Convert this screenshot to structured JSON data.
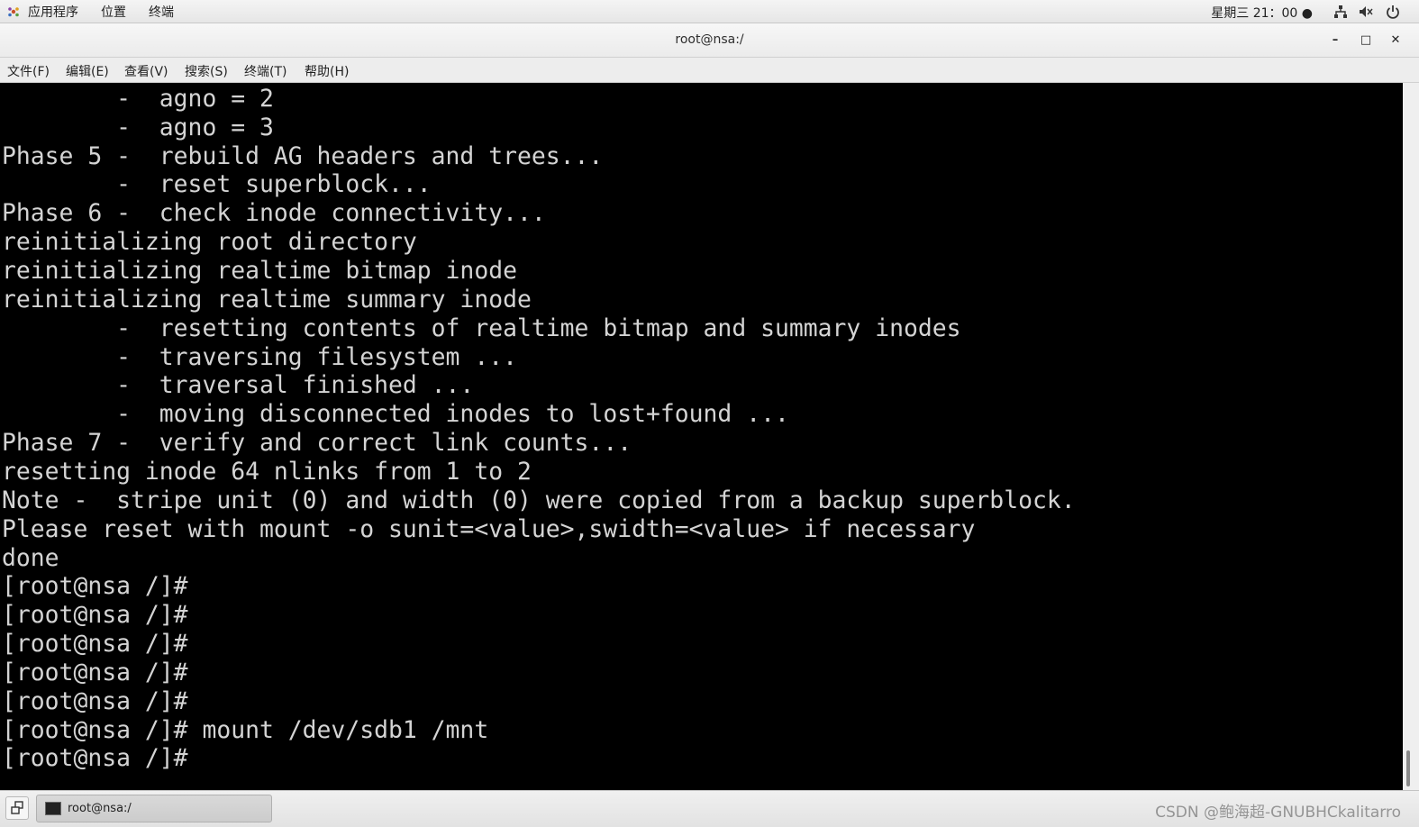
{
  "top_panel": {
    "apps_menu": "应用程序",
    "places_menu": "位置",
    "terminal_menu": "终端",
    "clock": "星期三 21：00 ●",
    "tray_icons": [
      "network-icon",
      "volume-icon",
      "power-icon"
    ]
  },
  "window": {
    "title": "root@nsa:/",
    "minimize": "–",
    "maximize": "□",
    "close": "✕"
  },
  "menu_bar": {
    "items": [
      {
        "label": "文件(F)"
      },
      {
        "label": "编辑(E)"
      },
      {
        "label": "查看(V)"
      },
      {
        "label": "搜索(S)"
      },
      {
        "label": "终端(T)"
      },
      {
        "label": "帮助(H)"
      }
    ]
  },
  "terminal": {
    "lines": [
      "        -  agno = 2",
      "        -  agno = 3",
      "Phase 5 -  rebuild AG headers and trees...",
      "        -  reset superblock...",
      "Phase 6 -  check inode connectivity...",
      "reinitializing root directory",
      "reinitializing realtime bitmap inode",
      "reinitializing realtime summary inode",
      "        -  resetting contents of realtime bitmap and summary inodes",
      "        -  traversing filesystem ...",
      "        -  traversal finished ...",
      "        -  moving disconnected inodes to lost+found ...",
      "Phase 7 -  verify and correct link counts...",
      "resetting inode 64 nlinks from 1 to 2",
      "Note -  stripe unit (0) and width (0) were copied from a backup superblock.",
      "Please reset with mount -o sunit=<value>,swidth=<value> if necessary",
      "done",
      "[root@nsa /]#",
      "[root@nsa /]#",
      "[root@nsa /]#",
      "[root@nsa /]#",
      "[root@nsa /]#",
      "[root@nsa /]# mount /dev/sdb1 /mnt",
      "[root@nsa /]#"
    ],
    "text_color": "#d4d4d4",
    "background_color": "#000000"
  },
  "taskbar": {
    "task_label": "root@nsa:/",
    "watermark": "CSDN @鲍海超-GNUBHCkalitarro"
  }
}
